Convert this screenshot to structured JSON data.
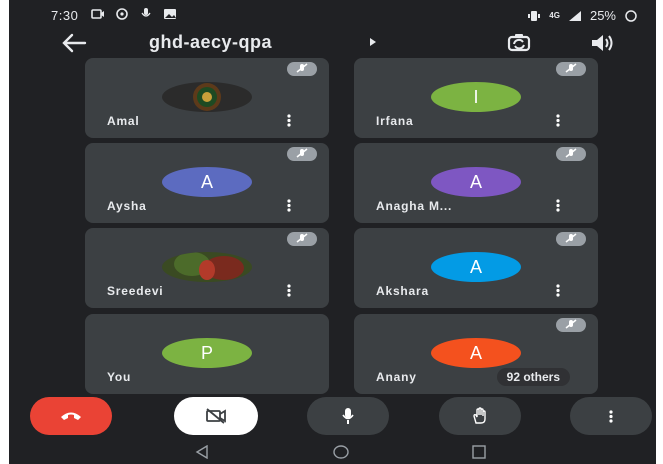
{
  "status_bar": {
    "time": "7:30",
    "battery": "25%",
    "network": "4G"
  },
  "header": {
    "title": "ghd-aecy-qpa"
  },
  "participants": [
    {
      "name": "Amal",
      "initial": "",
      "avatar": "photo-emblem",
      "muted": true
    },
    {
      "name": "Irfana",
      "initial": "I",
      "avatar_color": "#7cb342",
      "muted": true
    },
    {
      "name": "Aysha",
      "initial": "A",
      "avatar_color": "#5c6bc0",
      "muted": true
    },
    {
      "name": "Anagha M...",
      "initial": "A",
      "avatar_color": "#7e57c2",
      "muted": true
    },
    {
      "name": "Sreedevi",
      "initial": "",
      "avatar": "photo-portrait",
      "muted": true
    },
    {
      "name": "Akshara",
      "initial": "A",
      "avatar_color": "#039be5",
      "muted": true
    },
    {
      "name": "You",
      "initial": "P",
      "avatar_color": "#7cb342",
      "muted": false
    },
    {
      "name": "Anany",
      "initial": "A",
      "avatar_color": "#f4511e",
      "muted": true
    }
  ],
  "others_label": "92 others",
  "controls": {
    "end_call_color": "#ea4335",
    "camera_off_bg": "#ffffff",
    "icons": [
      "end-call-icon",
      "camera-off-icon",
      "mic-icon",
      "raise-hand-icon",
      "more-options-icon"
    ]
  },
  "colors": {
    "background": "#202124",
    "tile": "#3c4043"
  }
}
